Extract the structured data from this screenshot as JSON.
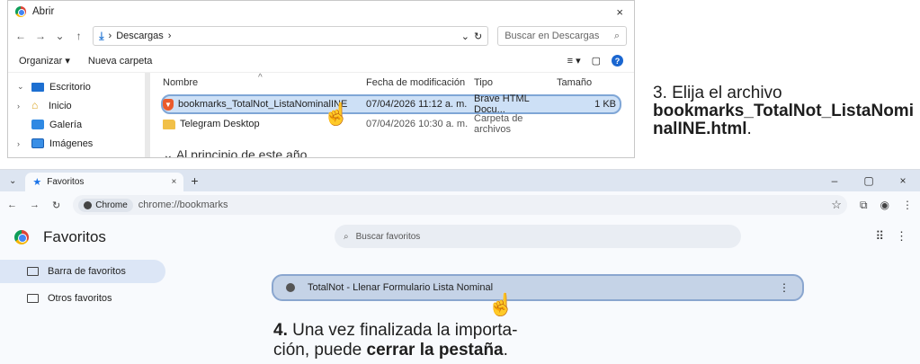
{
  "dialog": {
    "title": "Abrir",
    "close_glyph": "×",
    "breadcrumb": "Descargas",
    "breadcrumb_sep": "›",
    "search_placeholder": "Buscar en Descargas",
    "organize_label": "Organizar ▾",
    "new_folder_label": "Nueva carpeta",
    "tree": [
      {
        "label": "Escritorio",
        "expander": "⌄",
        "icon": "desktop-icon"
      },
      {
        "label": "Inicio",
        "expander": "›",
        "icon": "home-icon"
      },
      {
        "label": "Galería",
        "expander": "",
        "icon": "gallery-icon"
      },
      {
        "label": "Imágenes",
        "expander": "›",
        "icon": "pictures-icon"
      }
    ],
    "columns": [
      "Nombre",
      "Fecha de modificación",
      "Tipo",
      "Tamaño"
    ],
    "files": [
      {
        "name": "bookmarks_TotalNot_ListaNominalINE",
        "date": "07/04/2026 11:12 a. m.",
        "type": "Brave HTML Docu...",
        "size": "1 KB",
        "selected": true
      },
      {
        "name": "Telegram Desktop",
        "date": "07/04/2026 10:30 a. m.",
        "type": "Carpeta de archivos",
        "size": "",
        "selected": false
      }
    ],
    "partial_group": "⌄ Al principio de este año"
  },
  "step3": {
    "prefix": "3. Elija el archivo",
    "filename": "bookmarks_TotalNot_ListaNominalINE.html",
    "suffix": "."
  },
  "browser": {
    "tab_label": "Favoritos",
    "tab_close": "×",
    "new_tab": "+",
    "window_controls": [
      "–",
      "▢",
      "×"
    ],
    "chip_label": "Chrome",
    "url": "chrome://bookmarks",
    "page_title": "Favoritos",
    "search_placeholder": "Buscar favoritos",
    "sidebar": [
      "Barra de favoritos",
      "Otros favoritos"
    ],
    "bookmark": "TotalNot - Llenar Formulario Lista Nominal",
    "more_glyph": "⋮"
  },
  "step4": {
    "number": "4.",
    "text_a": " Una vez finalizada la importa-",
    "text_b": "ción, puede ",
    "bold": "cerrar la pestaña",
    "end": "."
  }
}
